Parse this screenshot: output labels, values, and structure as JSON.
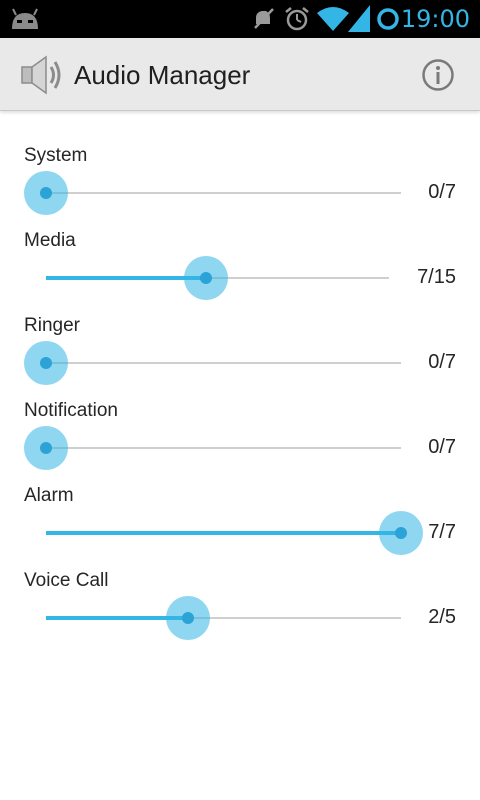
{
  "status_bar": {
    "time": "19:00",
    "icons": [
      "android-icon",
      "mute-icon",
      "alarm-icon",
      "wifi-icon",
      "signal-icon",
      "sync-ring-icon"
    ]
  },
  "action_bar": {
    "title": "Audio Manager",
    "app_icon": "speaker-icon",
    "info_icon": "info-icon"
  },
  "volumes": [
    {
      "label": "System",
      "value": 0,
      "max": 7,
      "display": "0/7"
    },
    {
      "label": "Media",
      "value": 7,
      "max": 15,
      "display": "7/15"
    },
    {
      "label": "Ringer",
      "value": 0,
      "max": 7,
      "display": "0/7"
    },
    {
      "label": "Notification",
      "value": 0,
      "max": 7,
      "display": "0/7"
    },
    {
      "label": "Alarm",
      "value": 7,
      "max": 7,
      "display": "7/7"
    },
    {
      "label": "Voice Call",
      "value": 2,
      "max": 5,
      "display": "2/5"
    }
  ],
  "colors": {
    "accent": "#33b5e5",
    "status_bar_bg": "#000000",
    "action_bar_bg": "#e9e9e9"
  }
}
